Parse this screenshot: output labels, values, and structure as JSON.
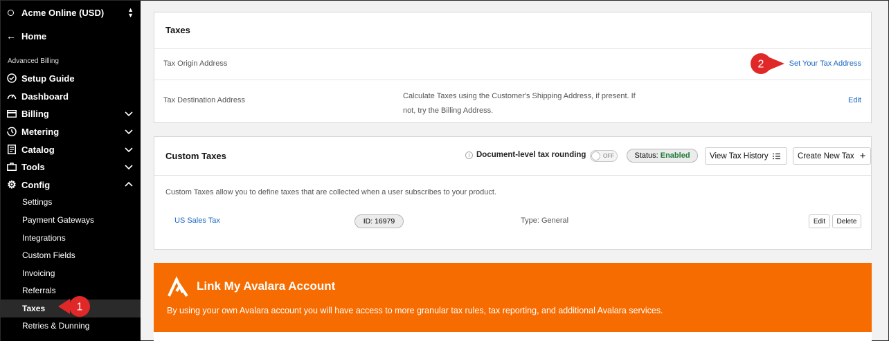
{
  "sidebar": {
    "account": "Acme Online (USD)",
    "home": "Home",
    "section": "Advanced Billing",
    "items": [
      {
        "label": "Setup Guide"
      },
      {
        "label": "Dashboard"
      },
      {
        "label": "Billing"
      },
      {
        "label": "Metering"
      },
      {
        "label": "Catalog"
      },
      {
        "label": "Tools"
      },
      {
        "label": "Config"
      }
    ],
    "config_items": [
      {
        "label": "Settings"
      },
      {
        "label": "Payment Gateways"
      },
      {
        "label": "Integrations"
      },
      {
        "label": "Custom Fields"
      },
      {
        "label": "Invoicing"
      },
      {
        "label": "Referrals"
      },
      {
        "label": "Taxes"
      },
      {
        "label": "Retries & Dunning"
      }
    ]
  },
  "taxes": {
    "title": "Taxes",
    "origin_label": "Tax Origin Address",
    "origin_link": "Set Your Tax Address",
    "dest_label": "Tax Destination Address",
    "dest_desc_line1": "Calculate Taxes using the Customer's Shipping Address, if present. If",
    "dest_desc_line2": "not, try the Billing Address.",
    "dest_edit": "Edit"
  },
  "custom_taxes": {
    "title": "Custom Taxes",
    "rounding_label": "Document-level tax rounding",
    "toggle_state": "OFF",
    "status_prefix": "Status:",
    "status_value": "Enabled",
    "history_button": "View Tax History",
    "create_button": "Create New Tax",
    "description": "Custom Taxes allow you to define taxes that are collected when a user subscribes to your product.",
    "rows": [
      {
        "name": "US Sales Tax",
        "id": "ID: 16979",
        "type": "Type: General",
        "edit": "Edit",
        "delete": "Delete"
      }
    ]
  },
  "avalara": {
    "title": "Link My Avalara Account",
    "description": "By using your own Avalara account you will have access to more granular tax rules, tax reporting, and additional Avalara services."
  },
  "callouts": [
    "1",
    "2"
  ],
  "colors": {
    "sidebar_bg": "#000000",
    "link": "#1a67c4",
    "status_enabled": "#1e7a3a",
    "avalara_orange": "#f66c00",
    "callout_red": "#e02828"
  }
}
